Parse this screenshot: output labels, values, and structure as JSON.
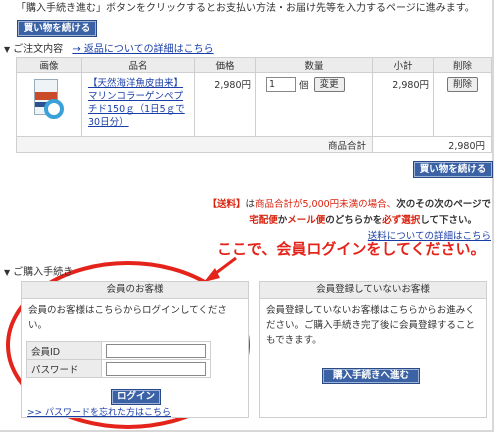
{
  "intro_text": "「購入手続き進む」ボタンをクリックするとお支払い方法・お届け先等を入力するページに進みます。",
  "continue_shopping_label": "買い物を続ける",
  "order": {
    "section_title": "ご注文内容",
    "returns_link": "→ 返品についての詳細はこちら",
    "headers": [
      "画像",
      "品名",
      "価格",
      "数量",
      "小計",
      "削除"
    ],
    "item": {
      "name": "【天然海洋魚皮由来】マリンコラーゲンペプチド150ｇ（1日5ｇで30日分）",
      "price": "2,980円",
      "qty": "1",
      "qty_unit": "個",
      "change_label": "変更",
      "subtotal": "2,980円",
      "delete_label": "削除"
    },
    "total_label": "商品合計",
    "total_value": "2,980円"
  },
  "shipping_notice": {
    "tag": "【送料】",
    "line1_a": "は",
    "line1_b": "商品合計が5,000円未満の場合、",
    "line1_c": "次のその次のページで",
    "line2_a": "宅配便",
    "line2_b": "か",
    "line2_c": "メール便",
    "line2_d": "のどちらかを",
    "line2_e": "必ず選択",
    "line2_f": "して下さい。",
    "link": "送料についての詳細はこちら"
  },
  "callout": "ここで、会員ログインをしてください。",
  "procedure_title": "ご購入手続き",
  "member": {
    "title": "会員のお客様",
    "text": "会員のお客様はこちらからログインしてください。",
    "id_label": "会員ID",
    "password_label": "パスワード",
    "id_value": "",
    "password_value": "",
    "login_label": "ログイン",
    "forgot_link": ">> パスワードを忘れた方はこちら"
  },
  "guest": {
    "title": "会員登録していないお客様",
    "text": "会員登録していないお客様はこちらからお進みください。ご購入手続き完了後に会員登録することもできます。",
    "proceed_label": "購入手続きへ進む"
  },
  "colors": {
    "button_blue": "#3b62a5",
    "alert_red": "#d9230f",
    "callout_red": "#e4241b",
    "link_blue": "#1a3ea8"
  }
}
